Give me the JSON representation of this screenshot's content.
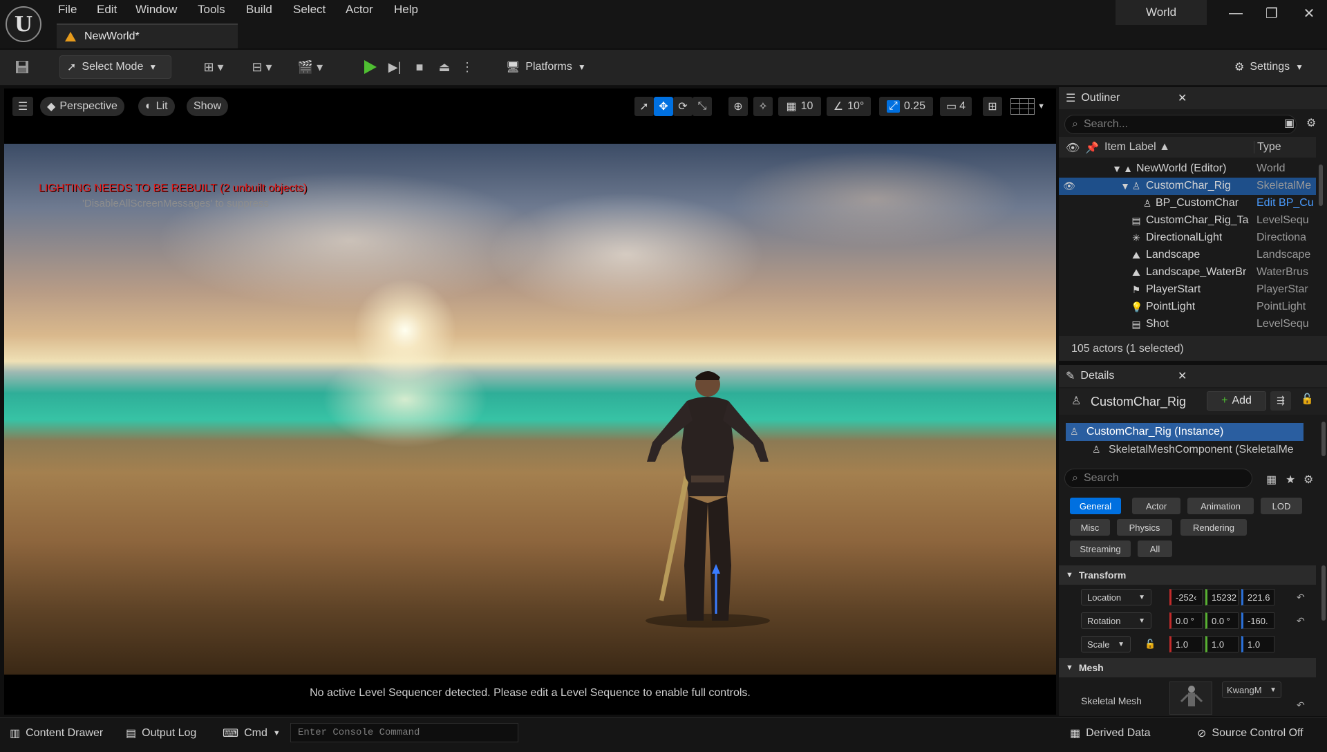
{
  "menu": {
    "items": [
      "File",
      "Edit",
      "Window",
      "Tools",
      "Build",
      "Select",
      "Actor",
      "Help"
    ],
    "world": "World"
  },
  "doc_tab": {
    "title": "NewWorld*"
  },
  "toolbar": {
    "select_mode": "Select Mode",
    "platforms": "Platforms",
    "settings": "Settings"
  },
  "viewport": {
    "perspective": "Perspective",
    "lit": "Lit",
    "show": "Show",
    "grid_snap": "10",
    "angle_snap": "10°",
    "scale_snap": "0.25",
    "camera_speed": "4",
    "warning": "LIGHTING NEEDS TO BE REBUILT (2 unbuilt objects)",
    "warning_hint": "'DisableAllScreenMessages' to suppress",
    "sequencer_msg": "No active Level Sequencer detected. Please edit a Level Sequence to enable full controls."
  },
  "outliner": {
    "title": "Outliner",
    "search_placeholder": "Search...",
    "col_label": "Item Label ▲",
    "col_type": "Type",
    "rows": [
      {
        "label": "NewWorld (Editor)",
        "type": "World"
      },
      {
        "label": "CustomChar_Rig",
        "type": "SkeletalMe"
      },
      {
        "label": "BP_CustomChar",
        "type": "Edit BP_Cu"
      },
      {
        "label": "CustomChar_Rig_Ta",
        "type": "LevelSequ"
      },
      {
        "label": "DirectionalLight",
        "type": "Directiona"
      },
      {
        "label": "Landscape",
        "type": "Landscape"
      },
      {
        "label": "Landscape_WaterBr",
        "type": "WaterBrus"
      },
      {
        "label": "PlayerStart",
        "type": "PlayerStar"
      },
      {
        "label": "PointLight",
        "type": "PointLight"
      },
      {
        "label": "Shot",
        "type": "LevelSequ"
      }
    ],
    "status": "105 actors (1 selected)"
  },
  "details": {
    "title": "Details",
    "actor": "CustomChar_Rig",
    "add": "Add",
    "components": [
      "CustomChar_Rig (Instance)",
      "SkeletalMeshComponent (SkeletalMe"
    ],
    "search_placeholder": "Search",
    "categories": [
      "General",
      "Actor",
      "Animation",
      "LOD",
      "Misc",
      "Physics",
      "Rendering",
      "Streaming",
      "All"
    ],
    "transform": {
      "header": "Transform",
      "location_label": "Location",
      "location": [
        "-252‹",
        "15232",
        "221.6"
      ],
      "rotation_label": "Rotation",
      "rotation": [
        "0.0 °",
        "0.0 °",
        "-160."
      ],
      "scale_label": "Scale",
      "scale": [
        "1.0",
        "1.0",
        "1.0"
      ]
    },
    "mesh": {
      "header": "Mesh",
      "skeletal_mesh_label": "Skeletal Mesh",
      "skeletal_mesh_value": "KwangM"
    }
  },
  "bottom": {
    "content_drawer": "Content Drawer",
    "output_log": "Output Log",
    "cmd": "Cmd",
    "console_placeholder": "Enter Console Command",
    "derived_data": "Derived Data",
    "source_control": "Source Control Off"
  },
  "colors": {
    "accent_blue": "#0070e0",
    "play_green": "#4fbf32",
    "warning_red": "#ee1c1c"
  }
}
